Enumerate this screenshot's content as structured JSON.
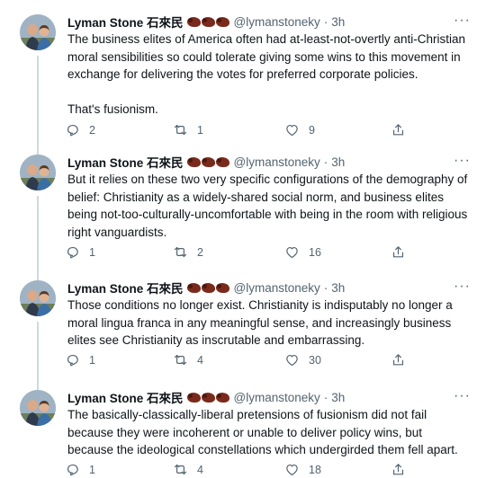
{
  "tweets": [
    {
      "name": "Lyman Stone 石來民",
      "handle": "@lymanstoneky",
      "dot": "·",
      "time": "3h",
      "more": "···",
      "paragraphs": [
        "The business elites of America often had at-least-not-overtly anti-Christian moral sensibilities so could tolerate giving some wins to this movement in exchange for delivering the votes for preferred corporate policies.",
        "That's fusionism."
      ],
      "replies": "2",
      "retweets": "1",
      "likes": "9"
    },
    {
      "name": "Lyman Stone 石來民",
      "handle": "@lymanstoneky",
      "dot": "·",
      "time": "3h",
      "more": "···",
      "paragraphs": [
        "But it relies on these two very specific configurations of the demography of belief: Christianity as a widely-shared social norm, and business elites being not-too-culturally-uncomfortable with being in the room with religious right vanguardists."
      ],
      "replies": "1",
      "retweets": "2",
      "likes": "16"
    },
    {
      "name": "Lyman Stone 石來民",
      "handle": "@lymanstoneky",
      "dot": "·",
      "time": "3h",
      "more": "···",
      "paragraphs": [
        "Those conditions no longer exist. Christianity is indisputably no longer a moral lingua franca in any meaningful sense, and increasingly business elites see Christianity as inscrutable and embarrassing."
      ],
      "replies": "1",
      "retweets": "4",
      "likes": "30"
    },
    {
      "name": "Lyman Stone 石來民",
      "handle": "@lymanstoneky",
      "dot": "·",
      "time": "3h",
      "more": "···",
      "paragraphs": [
        "The basically-classically-liberal pretensions of fusionism did not fail because they were incoherent or unable to deliver policy wins, but because the ideological constellations which undergirded them fell apart."
      ],
      "replies": "1",
      "retweets": "4",
      "likes": "18"
    }
  ],
  "colors": {
    "text": "#0f1419",
    "secondary": "#536471",
    "thread_line": "#cfd9de"
  },
  "icons": [
    "reply-icon",
    "retweet-icon",
    "like-icon",
    "share-icon",
    "bison-emoji"
  ]
}
